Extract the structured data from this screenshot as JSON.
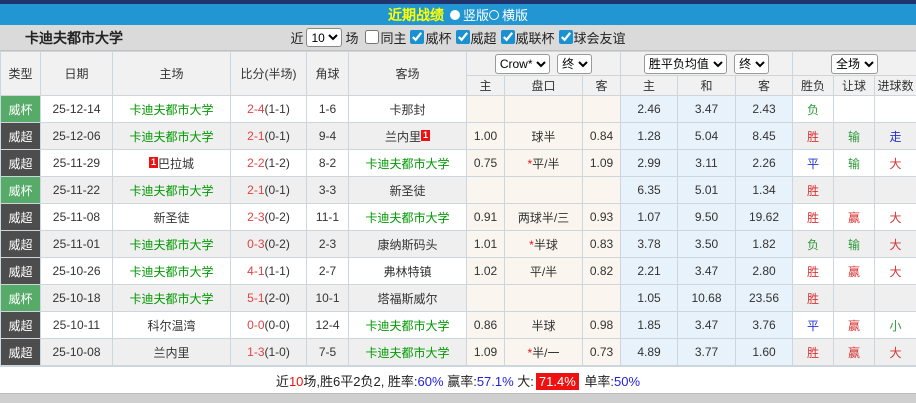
{
  "colors": {
    "accent_blue": "#2196d3",
    "navy": "#20356e",
    "title_yellow": "#ffff00",
    "cup_green": "#56ab68",
    "league_dark": "#4d4d4d",
    "team_green": "#009900",
    "score_red": "#e04343",
    "result_red": "#d93333",
    "result_green": "#2e9939",
    "result_blue": "#2233cc",
    "badge_red": "#ee1111",
    "asia_bg": "#faf5ee",
    "euro_bg": "#e8f2fa"
  },
  "titlebar": {
    "title": "近期战绩",
    "layout_options": [
      {
        "label": "竖版",
        "selected": true
      },
      {
        "label": "横版",
        "selected": false
      }
    ]
  },
  "toolbar": {
    "team_name": "卡迪夫都市大学",
    "near_label": "近",
    "count_value": "10",
    "matches_label": "场",
    "filters": [
      {
        "label": "同主",
        "checked": false
      },
      {
        "label": "威杯",
        "checked": true
      },
      {
        "label": "威超",
        "checked": true
      },
      {
        "label": "威联杯",
        "checked": true
      },
      {
        "label": "球会友谊",
        "checked": true
      }
    ]
  },
  "table": {
    "headers": {
      "type": "类型",
      "date": "日期",
      "home": "主场",
      "score": "比分(半场)",
      "corner": "角球",
      "away": "客场",
      "odds_source_select": "Crow*",
      "odds_time_select": "终",
      "europe_select": "胜平负均值",
      "europe_time_select": "终",
      "period_select": "全场",
      "sub_h_home": "主",
      "sub_handicap": "盘口",
      "sub_h_away": "客",
      "sub_o_home": "主",
      "sub_o_draw": "和",
      "sub_o_away": "客",
      "sub_result": "胜负",
      "sub_letgoal": "让球",
      "sub_goals": "进球数"
    },
    "rows": [
      {
        "type": "威杯",
        "type_style": "cup",
        "date": "25-12-14",
        "home": "卡迪夫都市大学",
        "home_highlight": true,
        "home_card": "",
        "home_card_pos": "",
        "score": "2-4",
        "half": "(1-1)",
        "corner": "1-6",
        "away": "卡那封",
        "away_highlight": false,
        "away_card": "",
        "away_card_pos": "",
        "h_home": "",
        "handicap": "",
        "handicap_star": false,
        "h_away": "",
        "o_home": "2.46",
        "o_draw": "3.47",
        "o_away": "2.43",
        "result": "负",
        "result_color": "green",
        "letgoal": "",
        "letgoal_color": "",
        "goals": "",
        "goals_color": ""
      },
      {
        "type": "威超",
        "type_style": "league",
        "date": "25-12-06",
        "home": "卡迪夫都市大学",
        "home_highlight": true,
        "home_card": "",
        "home_card_pos": "",
        "score": "2-1",
        "half": "(0-1)",
        "corner": "9-4",
        "away": "兰内里",
        "away_highlight": false,
        "away_card": "1",
        "away_card_pos": "after",
        "h_home": "1.00",
        "handicap": "球半",
        "handicap_star": false,
        "h_away": "0.84",
        "o_home": "1.28",
        "o_draw": "5.04",
        "o_away": "8.45",
        "result": "胜",
        "result_color": "red",
        "letgoal": "输",
        "letgoal_color": "green",
        "goals": "走",
        "goals_color": "blue"
      },
      {
        "type": "威超",
        "type_style": "league",
        "date": "25-11-29",
        "home": "巴拉城",
        "home_highlight": false,
        "home_card": "1",
        "home_card_pos": "before",
        "score": "2-2",
        "half": "(1-2)",
        "corner": "8-2",
        "away": "卡迪夫都市大学",
        "away_highlight": true,
        "away_card": "",
        "away_card_pos": "",
        "h_home": "0.75",
        "handicap": "平/半",
        "handicap_star": true,
        "h_away": "1.09",
        "o_home": "2.99",
        "o_draw": "3.11",
        "o_away": "2.26",
        "result": "平",
        "result_color": "blue",
        "letgoal": "输",
        "letgoal_color": "green",
        "goals": "大",
        "goals_color": "red"
      },
      {
        "type": "威杯",
        "type_style": "cup",
        "date": "25-11-22",
        "home": "卡迪夫都市大学",
        "home_highlight": true,
        "home_card": "",
        "home_card_pos": "",
        "score": "2-1",
        "half": "(0-1)",
        "corner": "3-3",
        "away": "新圣徒",
        "away_highlight": false,
        "away_card": "",
        "away_card_pos": "",
        "h_home": "",
        "handicap": "",
        "handicap_star": false,
        "h_away": "",
        "o_home": "6.35",
        "o_draw": "5.01",
        "o_away": "1.34",
        "result": "胜",
        "result_color": "red",
        "letgoal": "",
        "letgoal_color": "",
        "goals": "",
        "goals_color": ""
      },
      {
        "type": "威超",
        "type_style": "league",
        "date": "25-11-08",
        "home": "新圣徒",
        "home_highlight": false,
        "home_card": "",
        "home_card_pos": "",
        "score": "2-3",
        "half": "(0-2)",
        "corner": "11-1",
        "away": "卡迪夫都市大学",
        "away_highlight": true,
        "away_card": "",
        "away_card_pos": "",
        "h_home": "0.91",
        "handicap": "两球半/三",
        "handicap_star": false,
        "h_away": "0.93",
        "o_home": "1.07",
        "o_draw": "9.50",
        "o_away": "19.62",
        "result": "胜",
        "result_color": "red",
        "letgoal": "赢",
        "letgoal_color": "red",
        "goals": "大",
        "goals_color": "red"
      },
      {
        "type": "威超",
        "type_style": "league",
        "date": "25-11-01",
        "home": "卡迪夫都市大学",
        "home_highlight": true,
        "home_card": "",
        "home_card_pos": "",
        "score": "0-3",
        "half": "(0-2)",
        "corner": "2-3",
        "away": "康纳斯码头",
        "away_highlight": false,
        "away_card": "",
        "away_card_pos": "",
        "h_home": "1.01",
        "handicap": "半球",
        "handicap_star": true,
        "h_away": "0.83",
        "o_home": "3.78",
        "o_draw": "3.50",
        "o_away": "1.82",
        "result": "负",
        "result_color": "green",
        "letgoal": "输",
        "letgoal_color": "green",
        "goals": "大",
        "goals_color": "red"
      },
      {
        "type": "威超",
        "type_style": "league",
        "date": "25-10-26",
        "home": "卡迪夫都市大学",
        "home_highlight": true,
        "home_card": "",
        "home_card_pos": "",
        "score": "4-1",
        "half": "(1-1)",
        "corner": "2-7",
        "away": "弗林特镇",
        "away_highlight": false,
        "away_card": "",
        "away_card_pos": "",
        "h_home": "1.02",
        "handicap": "平/半",
        "handicap_star": false,
        "h_away": "0.82",
        "o_home": "2.21",
        "o_draw": "3.47",
        "o_away": "2.80",
        "result": "胜",
        "result_color": "red",
        "letgoal": "赢",
        "letgoal_color": "red",
        "goals": "大",
        "goals_color": "red"
      },
      {
        "type": "威杯",
        "type_style": "cup",
        "date": "25-10-18",
        "home": "卡迪夫都市大学",
        "home_highlight": true,
        "home_card": "",
        "home_card_pos": "",
        "score": "5-1",
        "half": "(2-0)",
        "corner": "10-1",
        "away": "塔福斯威尔",
        "away_highlight": false,
        "away_card": "",
        "away_card_pos": "",
        "h_home": "",
        "handicap": "",
        "handicap_star": false,
        "h_away": "",
        "o_home": "1.05",
        "o_draw": "10.68",
        "o_away": "23.56",
        "result": "胜",
        "result_color": "red",
        "letgoal": "",
        "letgoal_color": "",
        "goals": "",
        "goals_color": ""
      },
      {
        "type": "威超",
        "type_style": "league",
        "date": "25-10-11",
        "home": "科尔温湾",
        "home_highlight": false,
        "home_card": "",
        "home_card_pos": "",
        "score": "0-0",
        "half": "(0-0)",
        "corner": "12-4",
        "away": "卡迪夫都市大学",
        "away_highlight": true,
        "away_card": "",
        "away_card_pos": "",
        "h_home": "0.86",
        "handicap": "半球",
        "handicap_star": false,
        "h_away": "0.98",
        "o_home": "1.85",
        "o_draw": "3.47",
        "o_away": "3.76",
        "result": "平",
        "result_color": "blue",
        "letgoal": "赢",
        "letgoal_color": "red",
        "goals": "小",
        "goals_color": "green"
      },
      {
        "type": "威超",
        "type_style": "league",
        "date": "25-10-08",
        "home": "兰内里",
        "home_highlight": false,
        "home_card": "",
        "home_card_pos": "",
        "score": "1-3",
        "half": "(1-0)",
        "corner": "7-5",
        "away": "卡迪夫都市大学",
        "away_highlight": true,
        "away_card": "",
        "away_card_pos": "",
        "h_home": "1.09",
        "handicap": "半/一",
        "handicap_star": true,
        "h_away": "0.73",
        "o_home": "4.89",
        "o_draw": "3.77",
        "o_away": "1.60",
        "result": "胜",
        "result_color": "red",
        "letgoal": "赢",
        "letgoal_color": "red",
        "goals": "大",
        "goals_color": "red"
      }
    ]
  },
  "footer": {
    "segments": [
      {
        "text": "近",
        "style": "plain"
      },
      {
        "text": "10",
        "style": "red"
      },
      {
        "text": "场,胜6平2负2, 胜率:",
        "style": "plain"
      },
      {
        "text": "60%",
        "style": "blue"
      },
      {
        "text": " 赢率:",
        "style": "plain"
      },
      {
        "text": "57.1%",
        "style": "blue"
      },
      {
        "text": " 大:",
        "style": "plain"
      },
      {
        "text": "71.4%",
        "style": "red-badge"
      },
      {
        "text": " 单率:",
        "style": "plain"
      },
      {
        "text": "50%",
        "style": "blue"
      }
    ]
  }
}
